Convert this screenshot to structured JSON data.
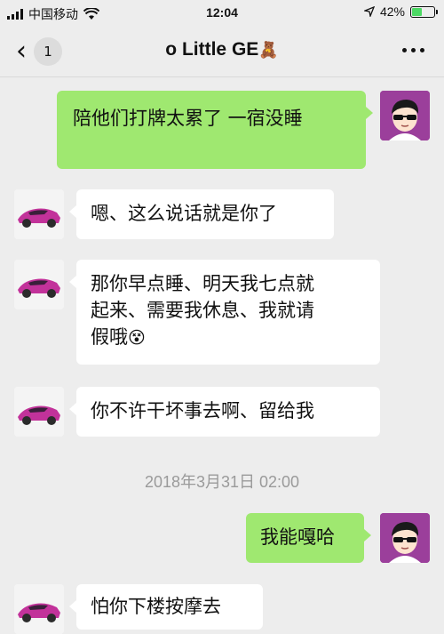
{
  "status_bar": {
    "carrier": "中国移动",
    "time": "12:04",
    "battery": "42%"
  },
  "nav": {
    "back_badge": "1",
    "title": "o Little GE",
    "title_emoji": "🧸"
  },
  "messages": [
    {
      "side": "out",
      "text": "陪他们打牌太累了 一宿没睡"
    },
    {
      "side": "in",
      "text": "嗯、这么说话就是你了"
    },
    {
      "side": "in",
      "line1": "那你早点睡、明天我七点就",
      "line2": "起来、需要我休息、我就请",
      "line3": "假哦",
      "emoji": "😵"
    },
    {
      "side": "in",
      "text": "你不许干坏事去啊、留给我"
    },
    {
      "side": "out",
      "text": "我能嘎哈"
    },
    {
      "side": "in",
      "text": "怕你下楼按摩去"
    }
  ],
  "timestamp": "2018年3月31日 02:00",
  "colors": {
    "background": "#ededed",
    "outgoing_bubble": "#9fe870",
    "incoming_bubble": "#ffffff",
    "avatar_bg_self": "#9b3f9b"
  }
}
